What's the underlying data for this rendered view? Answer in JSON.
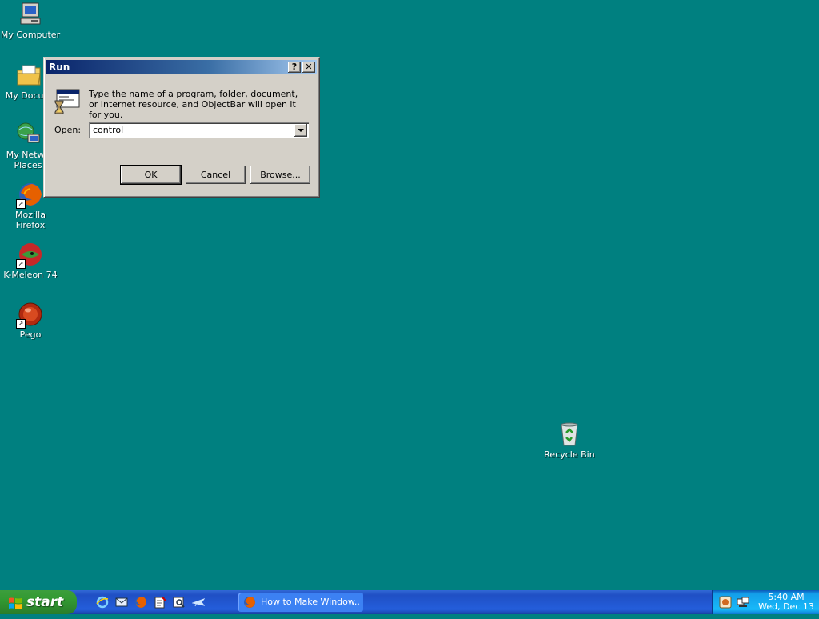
{
  "desktop": {
    "icons": [
      {
        "label": "My Computer"
      },
      {
        "label": "My Docum"
      },
      {
        "label": "My Netwo Places"
      },
      {
        "label": "Mozilla Firefox"
      },
      {
        "label": "K-Meleon 74"
      },
      {
        "label": "Pego"
      },
      {
        "label": "Recycle Bin"
      }
    ]
  },
  "run_dialog": {
    "title": "Run",
    "help_button": "?",
    "close_button": "✕",
    "prompt": "Type the name of a program, folder, document, or Internet resource, and ObjectBar will open it for you.",
    "open_label": "Open:",
    "open_value": "control",
    "buttons": {
      "ok": "OK",
      "cancel": "Cancel",
      "browse": "Browse..."
    }
  },
  "taskbar": {
    "start_label": "start",
    "quick_launch": [
      "ie-icon",
      "outlook-icon",
      "firefox-icon",
      "notepad-icon",
      "search-icon",
      "plane-icon"
    ],
    "task_button_label": "How to Make Window...",
    "clock": {
      "time": "5:40 AM",
      "date": "Wed, Dec 13"
    }
  },
  "colors": {
    "desktop_bg": "#008080",
    "taskbar": "#245edb",
    "start_button": "#329932",
    "dialog_face": "#d4d0c8"
  }
}
